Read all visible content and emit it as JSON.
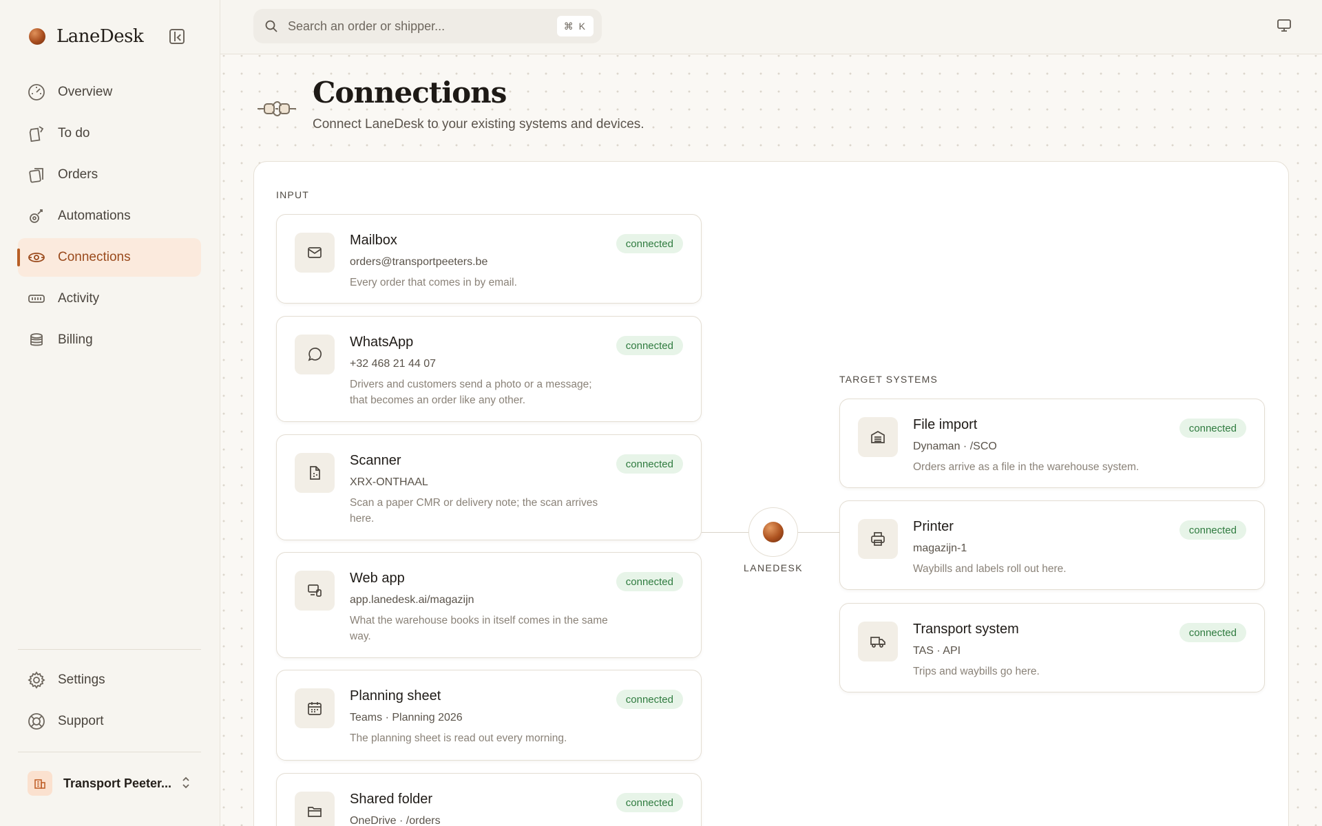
{
  "brand": {
    "name": "LaneDesk"
  },
  "nav": {
    "items": [
      {
        "label": "Overview",
        "icon": "gauge-icon"
      },
      {
        "label": "To do",
        "icon": "clipboard-icon"
      },
      {
        "label": "Orders",
        "icon": "orders-icon"
      },
      {
        "label": "Automations",
        "icon": "automation-icon"
      },
      {
        "label": "Connections",
        "icon": "connections-icon",
        "active": true
      },
      {
        "label": "Activity",
        "icon": "activity-icon"
      },
      {
        "label": "Billing",
        "icon": "coins-icon"
      }
    ],
    "bottom": [
      {
        "label": "Settings",
        "icon": "gear-icon"
      },
      {
        "label": "Support",
        "icon": "lifebuoy-icon"
      }
    ],
    "workspace": "Transport Peeter..."
  },
  "search": {
    "placeholder": "Search an order or shipper...",
    "shortcut": "⌘ K"
  },
  "page": {
    "title": "Connections",
    "subtitle": "Connect LaneDesk to your existing systems and devices."
  },
  "input": {
    "label": "INPUT",
    "cards": [
      {
        "title": "Mailbox",
        "sub": "orders@transportpeeters.be",
        "desc": "Every order that comes in by email.",
        "status": "connected",
        "icon": "mail-icon"
      },
      {
        "title": "WhatsApp",
        "sub": "+32 468 21 44 07",
        "desc": "Drivers and customers send a photo or a message; that becomes an order like any other.",
        "status": "connected",
        "icon": "chat-icon"
      },
      {
        "title": "Scanner",
        "sub": "XRX-ONTHAAL",
        "desc": "Scan a paper CMR or delivery note; the scan arrives here.",
        "status": "connected",
        "icon": "scan-icon"
      },
      {
        "title": "Web app",
        "sub": "app.lanedesk.ai/magazijn",
        "desc": "What the warehouse books in itself comes in the same way.",
        "status": "connected",
        "icon": "devices-icon"
      },
      {
        "title": "Planning sheet",
        "sub": "Teams · Planning 2026",
        "desc": "The planning sheet is read out every morning.",
        "status": "connected",
        "icon": "calendar-icon"
      },
      {
        "title": "Shared folder",
        "sub": "OneDrive · /orders",
        "desc": "",
        "status": "connected",
        "icon": "folder-icon"
      }
    ]
  },
  "hub": {
    "label": "LANEDESK"
  },
  "targets": {
    "label": "TARGET SYSTEMS",
    "cards": [
      {
        "title": "File import",
        "sub": "Dynaman · /SCO",
        "desc": "Orders arrive as a file in the warehouse system.",
        "status": "connected",
        "icon": "warehouse-icon"
      },
      {
        "title": "Printer",
        "sub": "magazijn-1",
        "desc": "Waybills and labels roll out here.",
        "status": "connected",
        "icon": "printer-icon"
      },
      {
        "title": "Transport system",
        "sub": "TAS · API",
        "desc": "Trips and waybills go here.",
        "status": "connected",
        "icon": "truck-icon"
      }
    ]
  },
  "colors": {
    "accent": "#b85f26",
    "connected_bg": "#e7f4e8",
    "connected_text": "#2f7b3f"
  }
}
